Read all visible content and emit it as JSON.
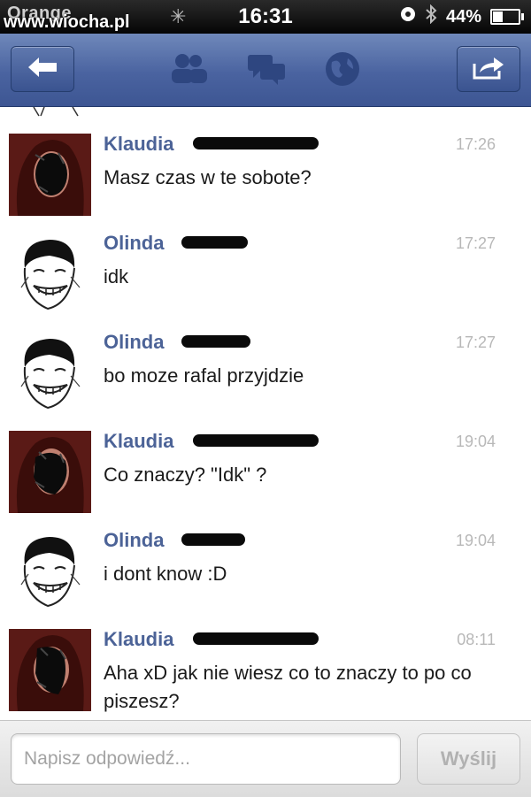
{
  "status_bar": {
    "carrier": "Orange",
    "watermark": "www.wiocha.pl",
    "time": "16:31",
    "battery": "44%",
    "battery_level": 0.44
  },
  "nav": {
    "back_icon": "back-arrow-icon",
    "tab_icons": [
      "friends-icon",
      "messages-icon",
      "notifications-globe-icon"
    ],
    "share_icon": "share-icon"
  },
  "messages": [
    {
      "sender": "Klaudia",
      "time": "17:26",
      "text": "Masz czas w te sobote?",
      "avatar": "klaudia-avatar"
    },
    {
      "sender": "Olinda",
      "time": "17:27",
      "text": "idk",
      "avatar": "meme-face-avatar"
    },
    {
      "sender": "Olinda",
      "time": "17:27",
      "text": "bo moze rafal przyjdzie",
      "avatar": "meme-face-avatar"
    },
    {
      "sender": "Klaudia",
      "time": "19:04",
      "text": "Co znaczy? \"Idk\" ?",
      "avatar": "klaudia-avatar"
    },
    {
      "sender": "Olinda",
      "time": "19:04",
      "text": "i dont know :D",
      "avatar": "meme-face-avatar"
    },
    {
      "sender": "Klaudia",
      "time": "08:11",
      "text": "Aha xD jak nie wiesz co to znaczy to po co piszesz?",
      "avatar": "klaudia-avatar"
    }
  ],
  "reply": {
    "placeholder": "Napisz odpowiedź...",
    "send_label": "Wyślij"
  },
  "colors": {
    "nav_bar": "#4a63a0",
    "sender_name": "#4c6397",
    "timestamp": "#b8b8b8"
  }
}
